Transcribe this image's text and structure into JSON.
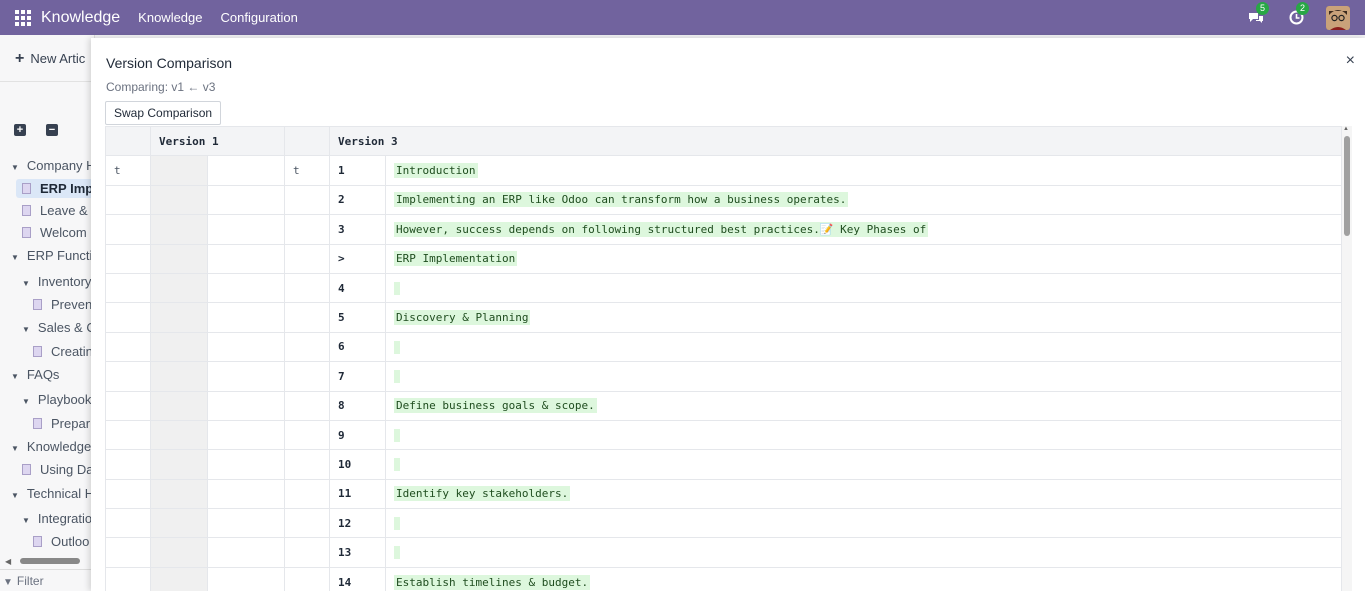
{
  "navbar": {
    "brand": "Knowledge",
    "menu": [
      "Knowledge",
      "Configuration"
    ],
    "chat_badge": "5",
    "activity_badge": "2"
  },
  "sidebar": {
    "new_article": "New Artic",
    "tree": [
      {
        "label": "Company H",
        "kind": "folder"
      },
      {
        "label": "ERP Imp",
        "kind": "doc",
        "active": true
      },
      {
        "label": "Leave &",
        "kind": "doc"
      },
      {
        "label": "Welcom",
        "kind": "doc"
      },
      {
        "label": "ERP Functio",
        "kind": "folder"
      },
      {
        "label": "Inventory",
        "kind": "subfolder"
      },
      {
        "label": "Preven",
        "kind": "subdoc"
      },
      {
        "label": "Sales & C",
        "kind": "subfolder"
      },
      {
        "label": "Creatin",
        "kind": "subdoc"
      },
      {
        "label": "FAQs",
        "kind": "folder"
      },
      {
        "label": "Playbook",
        "kind": "subfolder"
      },
      {
        "label": "Prepar",
        "kind": "subdoc"
      },
      {
        "label": "Knowledge",
        "kind": "folder"
      },
      {
        "label": "Using Da",
        "kind": "doc"
      },
      {
        "label": "Technical H",
        "kind": "folder"
      },
      {
        "label": "Integratio",
        "kind": "subfolder"
      },
      {
        "label": "Outloo",
        "kind": "subdoc"
      }
    ],
    "filter_placeholder": "Filter"
  },
  "modal": {
    "title": "Version Comparison",
    "subtitle": "Comparing: v1 ← v3",
    "swap_label": "Swap Comparison",
    "close_symbol": "×",
    "headers": {
      "left": "Version 1",
      "right": "Version 3"
    },
    "first_row_marker": "t",
    "rows": [
      {
        "ln": "1",
        "text": "Introduction"
      },
      {
        "ln": "2",
        "text": "Implementing an ERP like Odoo can transform how a business operates."
      },
      {
        "ln": "3",
        "text": "However, success depends on following structured best practices.📝 Key Phases of "
      },
      {
        "ln": ">",
        "text": "ERP Implementation"
      },
      {
        "ln": "4",
        "text": ""
      },
      {
        "ln": "5",
        "text": "Discovery & Planning"
      },
      {
        "ln": "6",
        "text": ""
      },
      {
        "ln": "7",
        "text": ""
      },
      {
        "ln": "8",
        "text": "Define business goals & scope."
      },
      {
        "ln": "9",
        "text": ""
      },
      {
        "ln": "10",
        "text": ""
      },
      {
        "ln": "11",
        "text": "Identify key stakeholders."
      },
      {
        "ln": "12",
        "text": ""
      },
      {
        "ln": "13",
        "text": ""
      },
      {
        "ln": "14",
        "text": "Establish timelines & budget."
      }
    ]
  }
}
